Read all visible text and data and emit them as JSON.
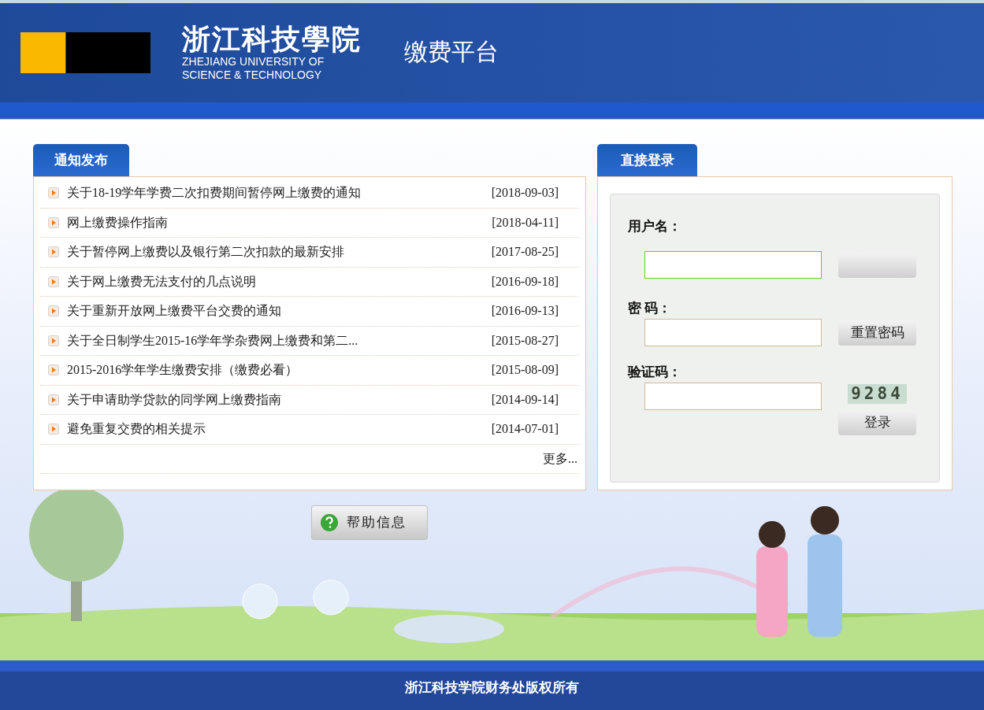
{
  "header": {
    "school_name_cn": "浙江科技學院",
    "school_name_en": [
      "ZHEJIANG UNIVERSITY OF",
      "SCIENCE & TECHNOLOGY"
    ],
    "platform_title": "缴费平台"
  },
  "notices": {
    "tab_label": "通知发布",
    "items": [
      {
        "title": "关于18-19学年学费二次扣费期间暂停网上缴费的通知",
        "date": "[2018-09-03]"
      },
      {
        "title": "网上缴费操作指南",
        "date": "[2018-04-11]"
      },
      {
        "title": "关于暂停网上缴费以及银行第二次扣款的最新安排",
        "date": "[2017-08-25]"
      },
      {
        "title": "关于网上缴费无法支付的几点说明",
        "date": "[2016-09-18]"
      },
      {
        "title": "关于重新开放网上缴费平台交费的通知",
        "date": "[2016-09-13]"
      },
      {
        "title": "关于全日制学生2015-16学年学杂费网上缴费和第二...",
        "date": "[2015-08-27]"
      },
      {
        "title": "2015-2016学年学生缴费安排（缴费必看）",
        "date": "[2015-08-09]"
      },
      {
        "title": "关于申请助学贷款的同学网上缴费指南",
        "date": "[2014-09-14]"
      },
      {
        "title": "避免重复交费的相关提示",
        "date": "[2014-07-01]"
      }
    ],
    "more": "更多..."
  },
  "login": {
    "tab_label": "直接登录",
    "rows": [
      {
        "label": "用户名：",
        "focused": true,
        "side": {
          "kind": "blank"
        }
      },
      {
        "label": "密 码：",
        "focused": false,
        "side": {
          "kind": "button",
          "label": "重置密码"
        }
      },
      {
        "label": "验证码：",
        "focused": false,
        "side": {
          "kind": "captcha",
          "text": "9284"
        }
      }
    ],
    "submit": "登录"
  },
  "help_button": "帮助信息",
  "footer": "浙江科技学院财务处版权所有"
}
